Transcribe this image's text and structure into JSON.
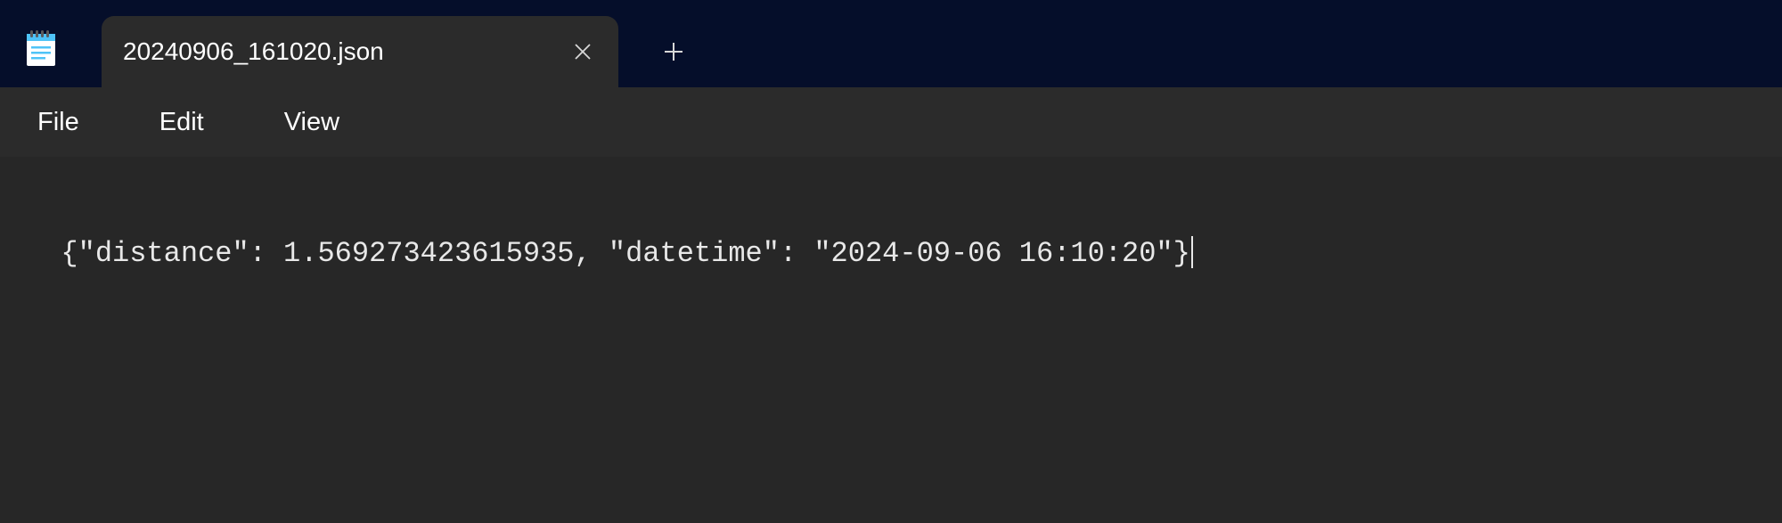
{
  "tab": {
    "title": "20240906_161020.json"
  },
  "menu": {
    "file": "File",
    "edit": "Edit",
    "view": "View"
  },
  "editor": {
    "content": "{\"distance\": 1.569273423615935, \"datetime\": \"2024-09-06 16:10:20\"}"
  }
}
